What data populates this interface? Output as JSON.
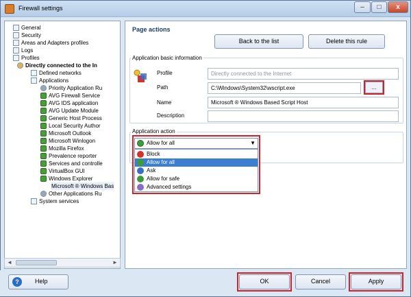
{
  "window": {
    "title": "Firewall settings",
    "minimize": "–",
    "maximize": "□",
    "close": "x"
  },
  "tree": {
    "items": [
      {
        "label": "General"
      },
      {
        "label": "Security"
      },
      {
        "label": "Areas and Adapters profiles"
      },
      {
        "label": "Logs"
      },
      {
        "label": "Profiles"
      },
      {
        "label": "Directly connected to the In"
      },
      {
        "label": "Defined networks"
      },
      {
        "label": "Applications"
      },
      {
        "label": "Priority Application Ru"
      },
      {
        "label": "AVG Firewall Service"
      },
      {
        "label": "AVG IDS application"
      },
      {
        "label": "AVG Update Module"
      },
      {
        "label": "Generic Host Process"
      },
      {
        "label": "Local Security Author"
      },
      {
        "label": "Microsoft Outlook"
      },
      {
        "label": "Microsoft Winlogon"
      },
      {
        "label": "Mozilla Firefox"
      },
      {
        "label": "Prevalence reporter"
      },
      {
        "label": "Services and controlle"
      },
      {
        "label": "VirtualBox GUI"
      },
      {
        "label": "Windows Explorer"
      },
      {
        "label": "Microsoft ® Windows Bas"
      },
      {
        "label": "Other Applications Ru"
      },
      {
        "label": "System services"
      }
    ],
    "scroll_left": "◄",
    "scroll_right": "►"
  },
  "page_actions": {
    "title": "Page actions",
    "back_label": "Back to the list",
    "delete_label": "Delete this rule"
  },
  "basic_info": {
    "group_label": "Application basic information",
    "profile_label": "Profile",
    "profile_value": "Directly connected to the Internet",
    "path_label": "Path",
    "path_value": "C:\\Windows\\System32\\wscript.exe",
    "browse_label": "...",
    "name_label": "Name",
    "name_value": "Microsoft ® Windows Based Script Host",
    "description_label": "Description",
    "description_value": ""
  },
  "app_action": {
    "group_label": "Application action",
    "selected": "Allow for all",
    "caret": "▼",
    "options": [
      {
        "label": "Block",
        "color": "#d4312a"
      },
      {
        "label": "Allow for all",
        "color": "#3d9b3b"
      },
      {
        "label": "Ask",
        "color": "#3a6fc8"
      },
      {
        "label": "Allow for safe",
        "color": "#3d9b3b"
      },
      {
        "label": "Advanced settings",
        "color": "#8a6cc8"
      }
    ]
  },
  "footer": {
    "help_label": "Help",
    "help_icon": "?",
    "ok_label": "OK",
    "cancel_label": "Cancel",
    "apply_label": "Apply"
  }
}
